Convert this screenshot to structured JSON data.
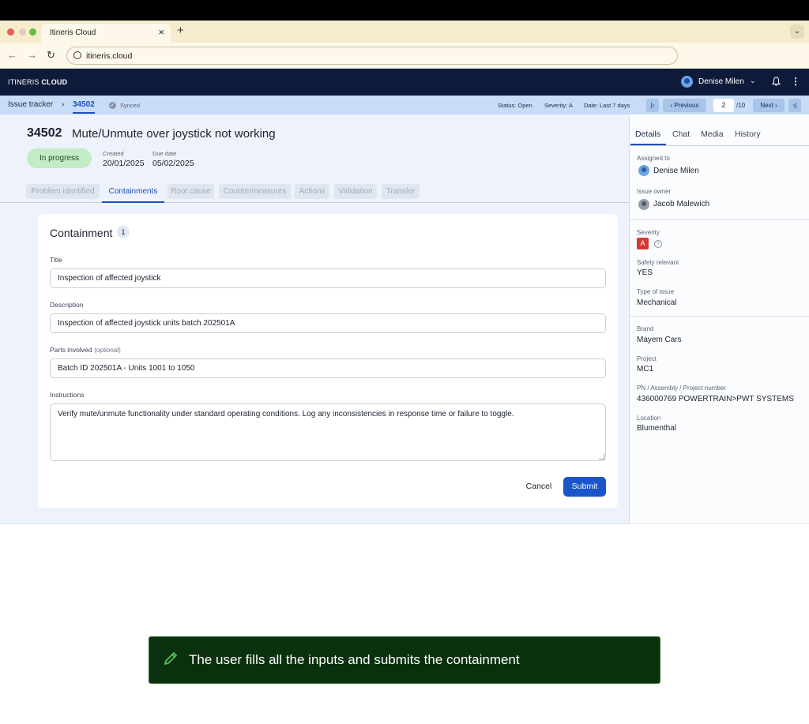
{
  "browser": {
    "tab_title": "Itineris Cloud",
    "url": "itineris.cloud",
    "new_tab_glyph": "+",
    "close_glyph": "×"
  },
  "app": {
    "brand_light": "ITINERIS ",
    "brand_bold": "CLOUD",
    "user_name": "Denise Milen"
  },
  "subheader": {
    "breadcrumb_root": "Issue tracker",
    "breadcrumb_sep": "›",
    "breadcrumb_id": "34502",
    "sync_status": "Synced",
    "filters": {
      "status": "Status: Open",
      "severity": "Severity: A",
      "date": "Date: Last 7 days"
    },
    "pagination": {
      "first": "|‹",
      "previous": "‹ Previous",
      "current": "2",
      "total": "/10",
      "next": "Next ›",
      "last": "›|"
    }
  },
  "issue": {
    "id": "34502",
    "title": "Mute/Unmute over joystick not working",
    "status": "In progress",
    "created_label": "Created",
    "created": "20/01/2025",
    "due_label": "Due date",
    "due": "05/02/2025",
    "steps": [
      "Problem identified",
      "Containments",
      "Root cause",
      "Countermeasures",
      "Actions",
      "Validation",
      "Transfer"
    ],
    "active_step": "Containments"
  },
  "form": {
    "heading": "Containment",
    "count": "1",
    "title_label": "Title",
    "title_value": "Inspection of affected joystick",
    "description_label": "Description",
    "description_value": "Inspection of affected joystick units batch 202501A",
    "parts_label": "Parts involved",
    "parts_optional": "(optional)",
    "parts_value": "Batch ID 202501A - Units 1001 to 1050",
    "instructions_label": "Instructions",
    "instructions_value": "Verify mute/unmute functionality under standard operating conditions. Log any inconsistencies in response time or failure to toggle.",
    "cancel": "Cancel",
    "submit": "Submit"
  },
  "details": {
    "tabs": [
      "Details",
      "Chat",
      "Media",
      "History"
    ],
    "assigned_label": "Assigned to",
    "assigned": "Denise Milen",
    "owner_label": "Issue owner",
    "owner": "Jacob Malewich",
    "severity_label": "Severity",
    "severity": "A",
    "safety_label": "Safety relevant",
    "safety": "YES",
    "type_label": "Type of issue",
    "type": "Mechanical",
    "brand_label": "Brand",
    "brand": "Mayem Cars",
    "project_label": "Project",
    "project": "MC1",
    "pn_label": "PN / Assembly / Project number",
    "pn": "436000769 POWERTRAIN>PWT SYSTEMS",
    "location_label": "Location",
    "location": "Blumenthal"
  },
  "caption": {
    "text": "The user fills all the inputs and submits the containment"
  },
  "colors": {
    "header_bg": "#0e1a3a",
    "accent": "#1a56c9",
    "status_green": "#c3ebc6",
    "severity_red": "#d33a32",
    "caption_bg": "#0a300d"
  }
}
